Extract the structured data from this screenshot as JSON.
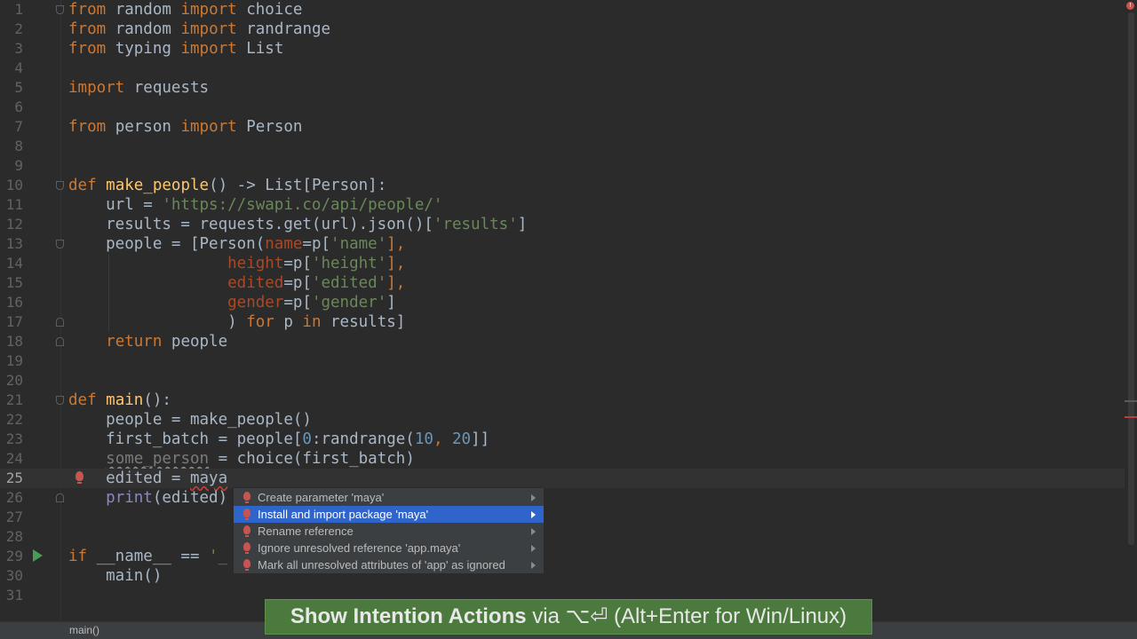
{
  "editor": {
    "current_line": 25,
    "lines": [
      {
        "n": "1",
        "tokens": [
          [
            "kw",
            "from"
          ],
          [
            "",
            "random "
          ],
          [
            "kw",
            "import"
          ],
          [
            "",
            "choice"
          ]
        ]
      },
      {
        "n": "2",
        "tokens": [
          [
            "kw",
            "from"
          ],
          [
            "",
            "random "
          ],
          [
            "kw",
            "import"
          ],
          [
            "",
            "randrange"
          ]
        ]
      },
      {
        "n": "3",
        "tokens": [
          [
            "kw",
            "from"
          ],
          [
            "",
            "typing "
          ],
          [
            "kw",
            "import"
          ],
          [
            "",
            "List"
          ]
        ]
      },
      {
        "n": "4",
        "tokens": []
      },
      {
        "n": "5",
        "tokens": [
          [
            "kw",
            "import"
          ],
          [
            "",
            "requests"
          ]
        ]
      },
      {
        "n": "6",
        "tokens": []
      },
      {
        "n": "7",
        "tokens": [
          [
            "kw",
            "from"
          ],
          [
            "",
            "person "
          ],
          [
            "kw",
            "import"
          ],
          [
            "",
            "Person"
          ]
        ]
      },
      {
        "n": "8",
        "tokens": []
      },
      {
        "n": "9",
        "tokens": []
      },
      {
        "n": "10",
        "tokens": [
          [
            "kw",
            "def"
          ],
          [
            "fn",
            "make_people"
          ],
          [
            "",
            "() -> List[Person]:"
          ]
        ]
      },
      {
        "n": "11",
        "tokens": [
          [
            "",
            "    url = "
          ],
          [
            "str",
            "'https://swapi.co/api/people/'"
          ]
        ]
      },
      {
        "n": "12",
        "tokens": [
          [
            "",
            "    results = requests.get(url).json()["
          ],
          [
            "str",
            "'results'"
          ],
          [
            "",
            "]"
          ]
        ]
      },
      {
        "n": "13",
        "tokens": [
          [
            "",
            "    people = [Person("
          ],
          [
            "prm",
            "name"
          ],
          [
            "",
            "=p["
          ],
          [
            "str",
            "'name'"
          ],
          [
            "kw",
            "],"
          ]
        ]
      },
      {
        "n": "14",
        "tokens": [
          [
            "",
            "                 "
          ],
          [
            "prm",
            "height"
          ],
          [
            "",
            "=p["
          ],
          [
            "str",
            "'height'"
          ],
          [
            "kw",
            "],"
          ]
        ]
      },
      {
        "n": "15",
        "tokens": [
          [
            "",
            "                 "
          ],
          [
            "prm",
            "edited"
          ],
          [
            "",
            "=p["
          ],
          [
            "str",
            "'edited'"
          ],
          [
            "kw",
            "],"
          ]
        ]
      },
      {
        "n": "16",
        "tokens": [
          [
            "",
            "                 "
          ],
          [
            "prm",
            "gender"
          ],
          [
            "",
            "=p["
          ],
          [
            "str",
            "'gender'"
          ],
          [
            "",
            "]"
          ]
        ]
      },
      {
        "n": "17",
        "tokens": [
          [
            "",
            "                 ) "
          ],
          [
            "kw",
            "for"
          ],
          [
            "",
            " p "
          ],
          [
            "kw",
            "in"
          ],
          [
            "",
            " results]"
          ]
        ]
      },
      {
        "n": "18",
        "tokens": [
          [
            "",
            "    "
          ],
          [
            "kw",
            "return"
          ],
          [
            "",
            " people"
          ]
        ]
      },
      {
        "n": "19",
        "tokens": []
      },
      {
        "n": "20",
        "tokens": []
      },
      {
        "n": "21",
        "tokens": [
          [
            "kw",
            "def"
          ],
          [
            "fn",
            "main"
          ],
          [
            "",
            "():"
          ]
        ]
      },
      {
        "n": "22",
        "tokens": [
          [
            "",
            "    people = make_people()"
          ]
        ]
      },
      {
        "n": "23",
        "tokens": [
          [
            "",
            "    first_batch = people["
          ],
          [
            "num",
            "0"
          ],
          [
            "",
            ":randrange("
          ],
          [
            "num",
            "10"
          ],
          [
            "kw",
            ","
          ],
          [
            "num",
            " 20"
          ],
          [
            "",
            "]]"
          ]
        ]
      },
      {
        "n": "24",
        "tokens": [
          [
            "",
            "    "
          ],
          [
            "unused",
            "some_person"
          ],
          [
            "",
            " = choice(first_batch)"
          ]
        ]
      },
      {
        "n": "25",
        "tokens": [
          [
            "",
            "    edited = "
          ],
          [
            "err",
            "maya"
          ]
        ]
      },
      {
        "n": "26",
        "tokens": [
          [
            "",
            "    "
          ],
          [
            "bi",
            "print"
          ],
          [
            "",
            "(edited)"
          ]
        ]
      },
      {
        "n": "27",
        "tokens": []
      },
      {
        "n": "28",
        "tokens": []
      },
      {
        "n": "29",
        "tokens": [
          [
            "kw",
            "if"
          ],
          [
            "",
            " __name__ == "
          ],
          [
            "str",
            "'_"
          ]
        ]
      },
      {
        "n": "30",
        "tokens": [
          [
            "",
            "    main()"
          ]
        ]
      },
      {
        "n": "31",
        "tokens": []
      }
    ]
  },
  "intention_popup": {
    "items": [
      {
        "label": "Create parameter 'maya'",
        "selected": false
      },
      {
        "label": "Install and import package 'maya'",
        "selected": true
      },
      {
        "label": "Rename reference",
        "selected": false
      },
      {
        "label": "Ignore unresolved reference 'app.maya'",
        "selected": false
      },
      {
        "label": "Mark all unresolved attributes of 'app' as ignored",
        "selected": false
      }
    ]
  },
  "statusbar": {
    "breadcrumb": "main()"
  },
  "tip": {
    "title": "Show Intention Actions",
    "rest": " via ⌥⏎ (Alt+Enter for Win/Linux)"
  },
  "icons": {
    "bulb": "lightbulb-error-icon",
    "run": "run-gutter-icon",
    "error": "error-stripe-icon"
  },
  "colors": {
    "background": "#2b2b2b",
    "keyword": "#cc7832",
    "function": "#ffc66d",
    "string": "#6a8759",
    "number": "#6897bb",
    "param": "#aa4926",
    "selection": "#2f65ca",
    "tip": "#4c7a3e"
  }
}
